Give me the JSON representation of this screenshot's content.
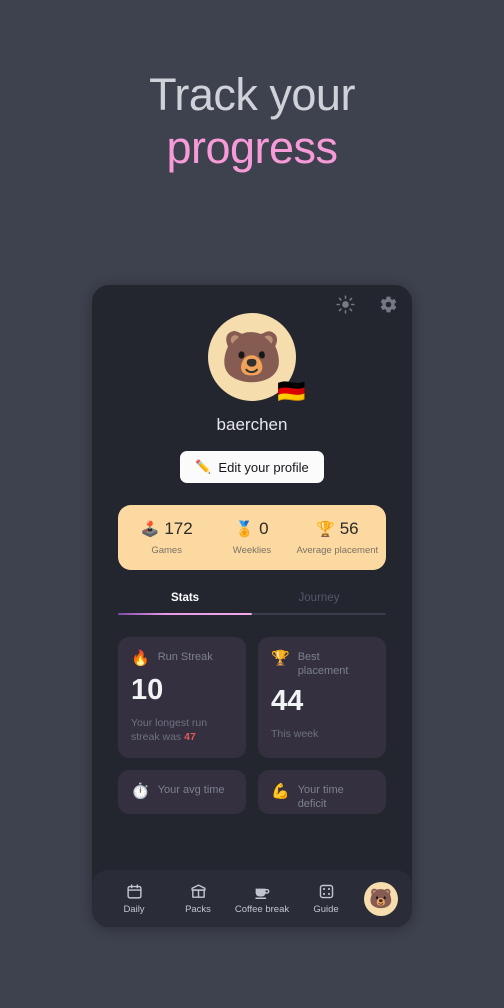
{
  "hero": {
    "line1": "Track your",
    "line2": "progress",
    "line1_color": "#cfd2d8",
    "line2_color": "#f79ad8"
  },
  "theme": {
    "page_bg": "#3e424e",
    "screen_bg": "#23252f",
    "card_bg": "#34303f",
    "banner_bg": "#fbd9a1",
    "accent_pink": "#e89ae8",
    "nav_bg": "#2a2d38",
    "danger_red": "#e0595c"
  },
  "topbar": {
    "theme_toggle_icon": "sun-icon",
    "settings_icon": "gear-icon"
  },
  "profile": {
    "avatar_emoji": "🐻",
    "avatar_icon": "bear-avatar",
    "flag_emoji": "🇩🇪",
    "flag_icon": "germany-flag-icon",
    "username": "baerchen",
    "edit_button_label": "Edit your profile",
    "edit_button_icon": "✏️"
  },
  "summary": [
    {
      "icon": "🕹️",
      "icon_name": "joystick-icon",
      "value": "172",
      "label": "Games"
    },
    {
      "icon": "🏅",
      "icon_name": "medal-icon",
      "value": "0",
      "label": "Weeklies"
    },
    {
      "icon": "🏆",
      "icon_name": "trophy-icon",
      "value": "56",
      "label": "Average placement"
    }
  ],
  "tabs": [
    {
      "label": "Stats",
      "active": true
    },
    {
      "label": "Journey",
      "active": false
    }
  ],
  "stat_cards": [
    {
      "icon": "🔥",
      "icon_name": "fire-icon",
      "title": "Run Streak",
      "value": "10",
      "footer_prefix": "Your longest run streak was ",
      "footer_highlight": "47"
    },
    {
      "icon": "🏆",
      "icon_name": "trophy-icon",
      "title": "Best placement",
      "value": "44",
      "footer_prefix": "This week",
      "footer_highlight": ""
    }
  ],
  "stat_cards_partial": [
    {
      "icon": "⏱️",
      "icon_name": "stopwatch-icon",
      "title": "Your avg time"
    },
    {
      "icon": "💪",
      "icon_name": "flexed-biceps-icon",
      "title": "Your time deficit"
    }
  ],
  "bottom_nav": {
    "items": [
      {
        "label": "Daily",
        "icon_name": "calendar-icon"
      },
      {
        "label": "Packs",
        "icon_name": "gift-box-icon"
      },
      {
        "label": "Coffee break",
        "icon_name": "coffee-cup-icon"
      },
      {
        "label": "Guide",
        "icon_name": "dice-icon"
      }
    ],
    "avatar_emoji": "🐻",
    "avatar_icon_name": "profile-avatar-icon"
  }
}
